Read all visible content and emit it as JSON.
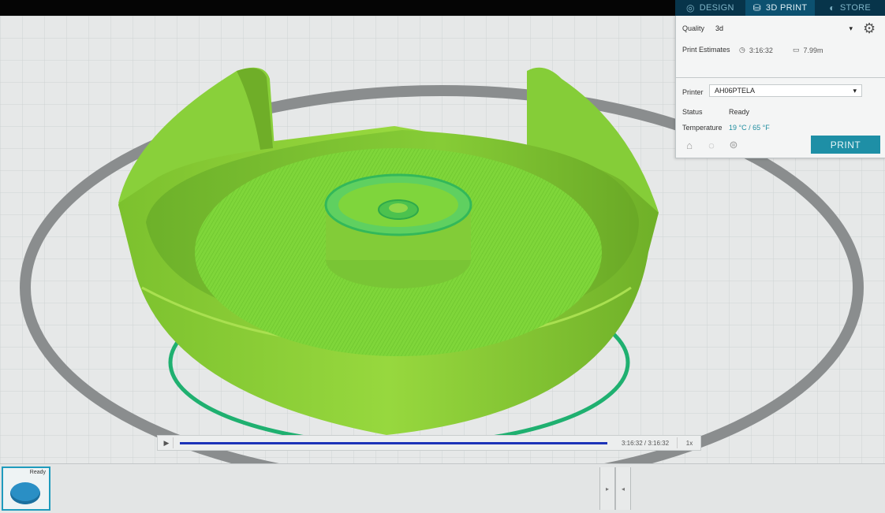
{
  "tabs": [
    {
      "label": "DESIGN",
      "icon": "globe-icon"
    },
    {
      "label": "3D PRINT",
      "icon": "printer-icon"
    },
    {
      "label": "STORE",
      "icon": "store-icon"
    }
  ],
  "panel": {
    "quality_label": "Quality",
    "quality_value": "3d",
    "estimates_label": "Print Estimates",
    "time_estimate": "3:16:32",
    "filament_estimate": "7.99m",
    "printer_label": "Printer",
    "printer_value": "AH06PTELA",
    "status_label": "Status",
    "status_value": "Ready",
    "temperature_label": "Temperature",
    "temperature_value": "19 °C / 65 °F",
    "print_button": "PRINT"
  },
  "playback": {
    "time": "3:16:32 / 3:16:32",
    "speed": "1x",
    "progress": 1.0
  },
  "thumbnail": {
    "status": "Ready"
  },
  "colors": {
    "model": "#8fd23a",
    "accent": "#1e8fa6",
    "progress": "#1c33b8",
    "ring": "#1fb070"
  }
}
